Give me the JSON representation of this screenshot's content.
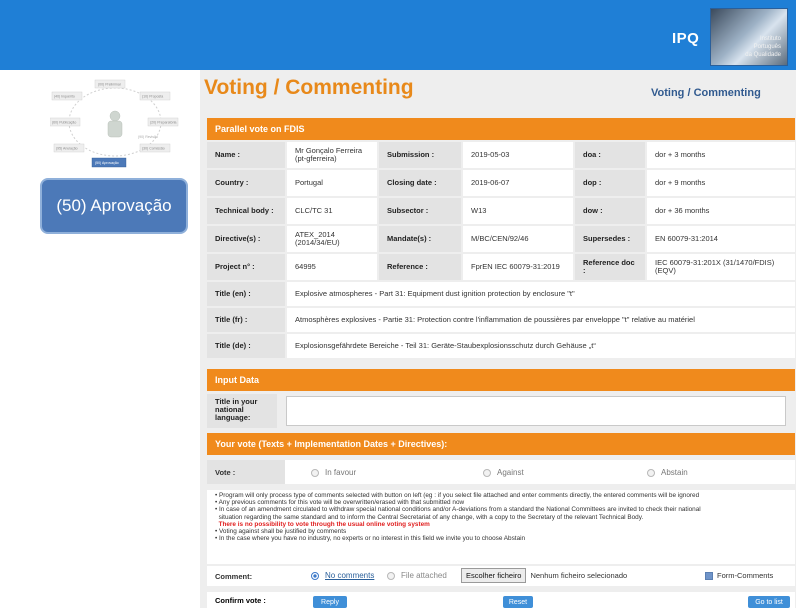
{
  "header": {
    "logo_text": "IPQ",
    "logo_caption_1": "Instituto",
    "logo_caption_2": "Português",
    "logo_caption_3": "da Qualidade"
  },
  "sidebar": {
    "stage_button": "(50) Aprovação",
    "diagram_nodes": [
      "(00) Preliminar",
      "(10) Proposta",
      "(20) Preparatória",
      "(30) Comissão",
      "(40) Inquérito",
      "(60) Publicação",
      "(95) Anulação",
      "(90) Revisão",
      "(50) Aprovação"
    ]
  },
  "page": {
    "title": "Voting / Commenting",
    "subtitle": "Voting / Commenting"
  },
  "parallel_vote": {
    "heading": "Parallel vote on FDIS",
    "rows": [
      [
        [
          "Name :",
          "Mr Gonçalo Ferreira (pt-gferreira)"
        ],
        [
          "Submission :",
          "2019-05-03"
        ],
        [
          "doa :",
          "dor + 3 months"
        ]
      ],
      [
        [
          "Country :",
          "Portugal"
        ],
        [
          "Closing date :",
          "2019-06-07"
        ],
        [
          "dop :",
          "dor + 9 months"
        ]
      ],
      [
        [
          "Technical body :",
          "CLC/TC 31"
        ],
        [
          "Subsector :",
          "W13"
        ],
        [
          "dow :",
          "dor + 36 months"
        ]
      ],
      [
        [
          "Directive(s) :",
          "ATEX_2014 (2014/34/EU)"
        ],
        [
          "Mandate(s) :",
          "M/BC/CEN/92/46"
        ],
        [
          "Supersedes :",
          "EN 60079-31:2014"
        ]
      ],
      [
        [
          "Project n° :",
          "64995"
        ],
        [
          "Reference :",
          "FprEN IEC 60079-31:2019"
        ],
        [
          "Reference doc :",
          "IEC 60079-31:201X (31/1470/FDIS) (EQV)"
        ]
      ]
    ],
    "titles": [
      [
        "Title (en) :",
        "Explosive atmospheres - Part 31: Equipment dust ignition protection by enclosure \"t\""
      ],
      [
        "Title (fr) :",
        "Atmosphères explosives - Partie 31: Protection contre l'inflammation de poussières par enveloppe \"t\" relative au matériel"
      ],
      [
        "Title (de) :",
        "Explosionsgefährdete Bereiche - Teil 31: Geräte-Staubexplosionsschutz durch Gehäuse „t“"
      ]
    ]
  },
  "input_data": {
    "heading": "Input Data",
    "label": "Title in your national language:",
    "value": ""
  },
  "vote": {
    "heading": "Your vote (Texts + Implementation Dates + Directives):",
    "label": "Vote :",
    "options": [
      "In favour",
      "Against",
      "Abstain"
    ],
    "notes": [
      "Program will only process type of comments selected with button on left (eg : if you select file attached and enter comments directly, the entered comments will be ignored",
      "Any previous comments for this vote will be overwritten/erased with that submitted now",
      "In case of an amendment circulated to withdraw special national conditions and/or A-deviations from a standard the National Committees are invited to check their national",
      "situation regarding the same standard and to inform the Central Secretariat of any change, with a copy to the Secretary of the relevant Technical Body.",
      "There is no possibility to vote through the usual online voting system",
      "Voting against shall be justified by comments",
      "In the case where you have no industry, no experts or no interest in this field we invite you to choose Abstain"
    ],
    "comment_label": "Comment:",
    "comment_options": [
      "No comments",
      "File attached"
    ],
    "file_button": "Escolher ficheiro",
    "file_status": "Nenhum ficheiro selecionado",
    "form_comments": "Form-Comments",
    "confirm_label": "Confirm vote :",
    "buttons": [
      "Reply",
      "Reset",
      "Go to list"
    ]
  },
  "colors": {
    "header_blue": "#1f7fd6",
    "orange": "#f08a1c",
    "stage_blue": "#4c79b8"
  }
}
